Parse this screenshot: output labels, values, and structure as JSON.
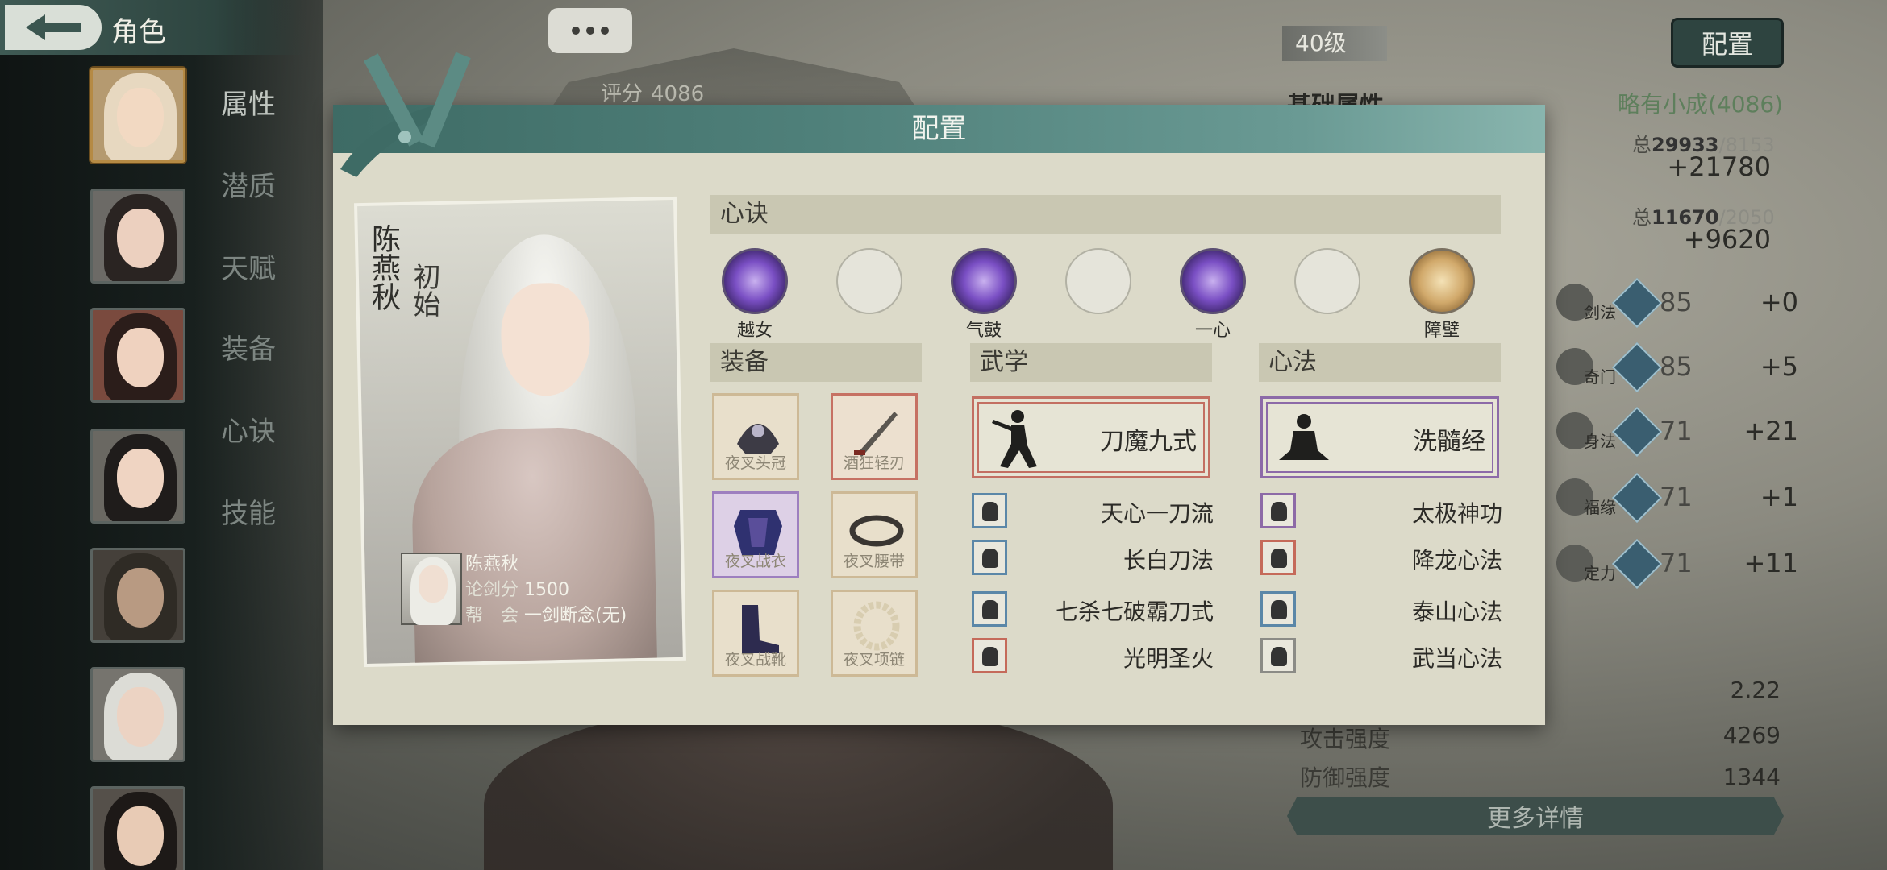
{
  "header": {
    "title": "角色",
    "score_label": "评分",
    "score_value": "4086",
    "level": "40级",
    "config_button": "配置"
  },
  "sidebar": {
    "tabs": [
      "属性",
      "潜质",
      "天赋",
      "装备",
      "心诀",
      "技能"
    ],
    "active_tab": "属性"
  },
  "attributes": {
    "title": "基础属性",
    "rank": "略有小成(4086)",
    "total1_prefix": "总",
    "total1_current": "29933",
    "total1_max": "/8153",
    "bonus1": "+21780",
    "total2_prefix": "总",
    "total2_current": "11670",
    "total2_max": "/2050",
    "bonus2": "+9620",
    "skills": [
      {
        "label": "剑法",
        "value": "85",
        "bonus": "+0"
      },
      {
        "label": "奇门",
        "value": "85",
        "bonus": "+5"
      },
      {
        "label": "身法",
        "value": "71",
        "bonus": "+21"
      },
      {
        "label": "福缘",
        "value": "71",
        "bonus": "+1"
      },
      {
        "label": "定力",
        "value": "71",
        "bonus": "+11"
      }
    ],
    "bottom": [
      {
        "name": "",
        "value": "2.22"
      },
      {
        "name": "攻击强度",
        "value": "4269"
      },
      {
        "name": "防御强度",
        "value": "1344"
      }
    ],
    "more_details": "更多详情"
  },
  "modal": {
    "title": "配置",
    "character": {
      "name": "陈燕秋",
      "stage": "初始",
      "info_name": "陈燕秋",
      "duel_label": "论剑分",
      "duel_value": "1500",
      "guild_label": "帮　会",
      "guild_value": "一剑断念(无)"
    },
    "heart_section": "心诀",
    "heart_slots": [
      {
        "label": "越女",
        "type": "purple"
      },
      {
        "label": "",
        "type": "empty"
      },
      {
        "label": "气鼓",
        "type": "purple"
      },
      {
        "label": "",
        "type": "empty"
      },
      {
        "label": "一心",
        "type": "purple"
      },
      {
        "label": "",
        "type": "empty"
      },
      {
        "label": "障壁",
        "type": "gold"
      }
    ],
    "equip_section": "装备",
    "equipment": [
      {
        "name": "夜叉头冠",
        "rarity": "normal"
      },
      {
        "name": "酒狂轻刃",
        "rarity": "red"
      },
      {
        "name": "夜叉战衣",
        "rarity": "purple"
      },
      {
        "name": "夜叉腰带",
        "rarity": "normal"
      },
      {
        "name": "夜叉战靴",
        "rarity": "normal"
      },
      {
        "name": "夜叉项链",
        "rarity": "normal"
      }
    ],
    "martial_section": "武学",
    "martial_main": "刀魔九式",
    "martial_list": [
      {
        "name": "天心一刀流",
        "color": "blue"
      },
      {
        "name": "长白刀法",
        "color": "blue"
      },
      {
        "name": "七杀七破霸刀式",
        "color": "blue"
      },
      {
        "name": "光明圣火",
        "color": "red"
      }
    ],
    "method_section": "心法",
    "method_main": "洗髓经",
    "method_list": [
      {
        "name": "太极神功",
        "color": "purple"
      },
      {
        "name": "降龙心法",
        "color": "red"
      },
      {
        "name": "泰山心法",
        "color": "blue"
      },
      {
        "name": "武当心法",
        "color": "gray"
      }
    ]
  },
  "colors": {
    "modal_header": "#4f807a",
    "modal_body": "#dcdac9",
    "accent_red": "#c36f62",
    "accent_purple": "#8c6aa8",
    "accent_blue": "#5b87a8",
    "accent_gold": "#b58a44"
  },
  "icons": [
    "back-arrow-icon",
    "chat-bubble-icon",
    "diamond-skill-icon"
  ]
}
